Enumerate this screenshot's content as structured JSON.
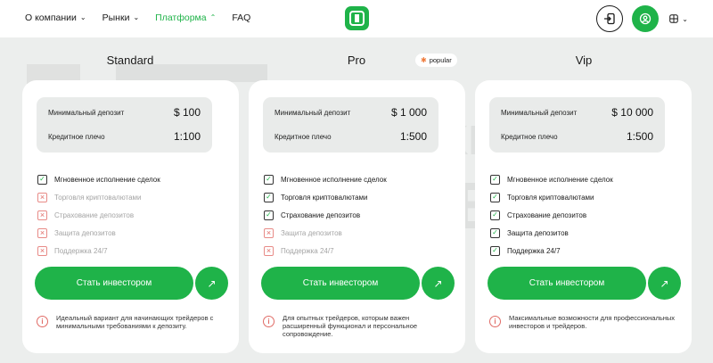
{
  "nav": {
    "items": [
      {
        "label": "О компании",
        "has_dropdown": true
      },
      {
        "label": "Рынки",
        "has_dropdown": true
      },
      {
        "label": "Платформа",
        "has_dropdown": true,
        "active": true
      },
      {
        "label": "FAQ",
        "has_dropdown": false
      }
    ]
  },
  "header": {
    "logo_icon": "brand-logo-icon",
    "login_icon": "login-icon",
    "profile_icon": "profile-icon",
    "language_icon": "globe-icon"
  },
  "colors": {
    "accent": "#1fb349",
    "warn": "#e06b66",
    "badge_star": "#ef7a3a"
  },
  "watermark": {
    "line1": "BROKER",
    "line2": "TRIBUNAL"
  },
  "plans": [
    {
      "title": "Standard",
      "min_deposit_label": "Минимальный депозит",
      "min_deposit_value": "$ 100",
      "leverage_label": "Кредитное плечо",
      "leverage_value": "1:100",
      "features": [
        {
          "label": "Мгновенное исполнение сделок",
          "included": true
        },
        {
          "label": "Торговля криптовалютами",
          "included": false
        },
        {
          "label": "Страхование депозитов",
          "included": false
        },
        {
          "label": "Защита депозитов",
          "included": false
        },
        {
          "label": "Поддержка 24/7",
          "included": false
        }
      ],
      "cta_label": "Стать инвестором",
      "note": "Идеальный вариант для начинающих трейдеров с минимальными требованиями к депозиту."
    },
    {
      "title": "Pro",
      "badge": "popular",
      "min_deposit_label": "Минимальный депозит",
      "min_deposit_value": "$ 1 000",
      "leverage_label": "Кредитное плечо",
      "leverage_value": "1:500",
      "features": [
        {
          "label": "Мгновенное исполнение сделок",
          "included": true
        },
        {
          "label": "Торговля криптовалютами",
          "included": true
        },
        {
          "label": "Страхование депозитов",
          "included": true
        },
        {
          "label": "Защита депозитов",
          "included": false
        },
        {
          "label": "Поддержка 24/7",
          "included": false
        }
      ],
      "cta_label": "Стать инвестором",
      "note": "Для опытных трейдеров, которым важен расширенный функционал и персональное сопровождение."
    },
    {
      "title": "Vip",
      "min_deposit_label": "Минимальный депозит",
      "min_deposit_value": "$ 10 000",
      "leverage_label": "Кредитное плечо",
      "leverage_value": "1:500",
      "features": [
        {
          "label": "Мгновенное исполнение сделок",
          "included": true
        },
        {
          "label": "Торговля криптовалютами",
          "included": true
        },
        {
          "label": "Страхование депозитов",
          "included": true
        },
        {
          "label": "Защита депозитов",
          "included": true
        },
        {
          "label": "Поддержка 24/7",
          "included": true
        }
      ],
      "cta_label": "Стать инвестором",
      "note": "Максимальные возможности для профессиональных инвесторов и трейдеров."
    }
  ]
}
